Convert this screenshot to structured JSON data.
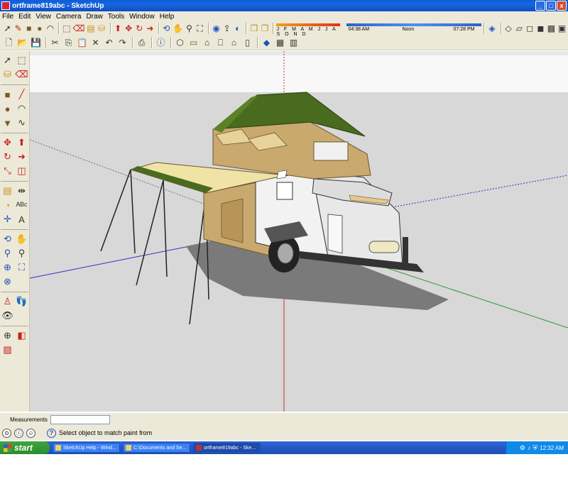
{
  "window": {
    "title": "ortframe819abc - SketchUp",
    "buttons": [
      "_",
      "□",
      "x"
    ]
  },
  "menu": [
    "File",
    "Edit",
    "View",
    "Camera",
    "Draw",
    "Tools",
    "Window",
    "Help"
  ],
  "shadows": {
    "months": "J F M A M J J A S O N D",
    "time_start": "04:38 AM",
    "time_mid": "Noon",
    "time_end": "07:28 PM"
  },
  "measurements": {
    "label": "Measurements",
    "value": ""
  },
  "status": {
    "text": "Select object to match paint from"
  },
  "taskbar": {
    "start": "start",
    "tasks": [
      "SketchUp Help - Wind...",
      "C:\\Documents and Se...",
      "ortframe819abc - Ske..."
    ],
    "clock": "12:32 AM"
  },
  "colors": {
    "sky": "#fafafa",
    "ground": "#d9d9d9",
    "tent_roof": "#4a6b1d",
    "tent_wall": "#c9a96e",
    "awning": "#efe3a6",
    "trailer_body": "#f2f2f2"
  }
}
